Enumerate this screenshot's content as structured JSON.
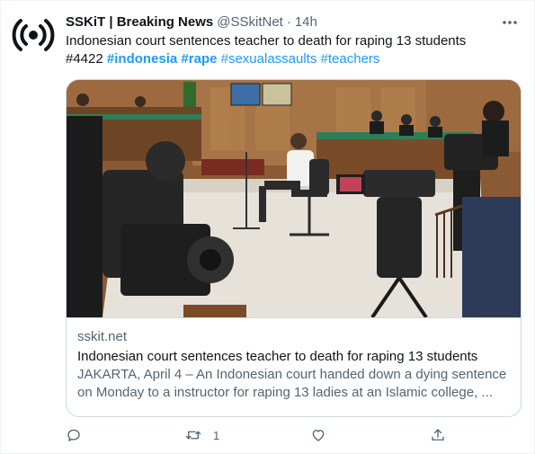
{
  "tweet": {
    "author_name": "SSKiT | Breaking News",
    "author_handle": "@SSkitNet",
    "separator": "·",
    "time": "14h",
    "text": "Indonesian court sentences teacher to death for raping 13 students",
    "tweet_id_text": "#4422",
    "hashtags": [
      "#indonesia",
      "#rape",
      "#sexualassaults",
      "#teachers"
    ]
  },
  "card": {
    "domain": "sskit.net",
    "title": "Indonesian court sentences teacher to death for raping 13 students",
    "description_line1": "JAKARTA, April 4 – An Indonesian court handed down a dying sentence",
    "description_line2": "on Monday to a instructor for raping 13 ladies at an Islamic college, ..."
  },
  "actions": {
    "reply_icon": "reply-icon",
    "retweet_icon": "retweet-icon",
    "retweet_count": "1",
    "like_icon": "like-icon",
    "share_icon": "share-icon"
  },
  "colors": {
    "link": "#1d9bf0",
    "secondary_text": "#536471",
    "primary_text": "#0f1419",
    "border": "#cfd9de"
  }
}
